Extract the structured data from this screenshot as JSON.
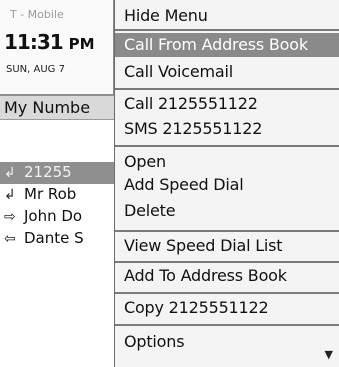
{
  "status": {
    "carrier": "T - Mobile",
    "time": "11:31",
    "ampm": "PM",
    "date": "SUN, AUG 7"
  },
  "header": {
    "label": "My Numbe"
  },
  "call_log": [
    {
      "icon": "missed-call-icon",
      "glyph": "↲",
      "text": "21255",
      "selected": true
    },
    {
      "icon": "incoming-call-icon",
      "glyph": "↲",
      "text": "Mr Rob",
      "selected": false
    },
    {
      "icon": "outgoing-call-icon",
      "glyph": "⇨",
      "text": "John Do",
      "selected": false
    },
    {
      "icon": "incoming-call-icon",
      "glyph": "⇦",
      "text": "Dante S",
      "selected": false
    }
  ],
  "menu": {
    "items": [
      {
        "label": "Hide Menu",
        "highlighted": false
      },
      {
        "label": "Call From Address Book",
        "highlighted": true
      },
      {
        "label": "Call Voicemail",
        "highlighted": false
      },
      {
        "label": "Call 2125551122",
        "highlighted": false
      },
      {
        "label": "SMS 2125551122",
        "highlighted": false
      },
      {
        "label": "Open",
        "highlighted": false
      },
      {
        "label": "Add Speed Dial",
        "highlighted": false
      },
      {
        "label": "Delete",
        "highlighted": false
      },
      {
        "label": "View Speed Dial List",
        "highlighted": false
      },
      {
        "label": "Add To Address Book",
        "highlighted": false
      },
      {
        "label": "Copy 2125551122",
        "highlighted": false
      },
      {
        "label": "Options",
        "highlighted": false
      }
    ],
    "scroll_icon": "scroll-down-arrow-icon"
  }
}
